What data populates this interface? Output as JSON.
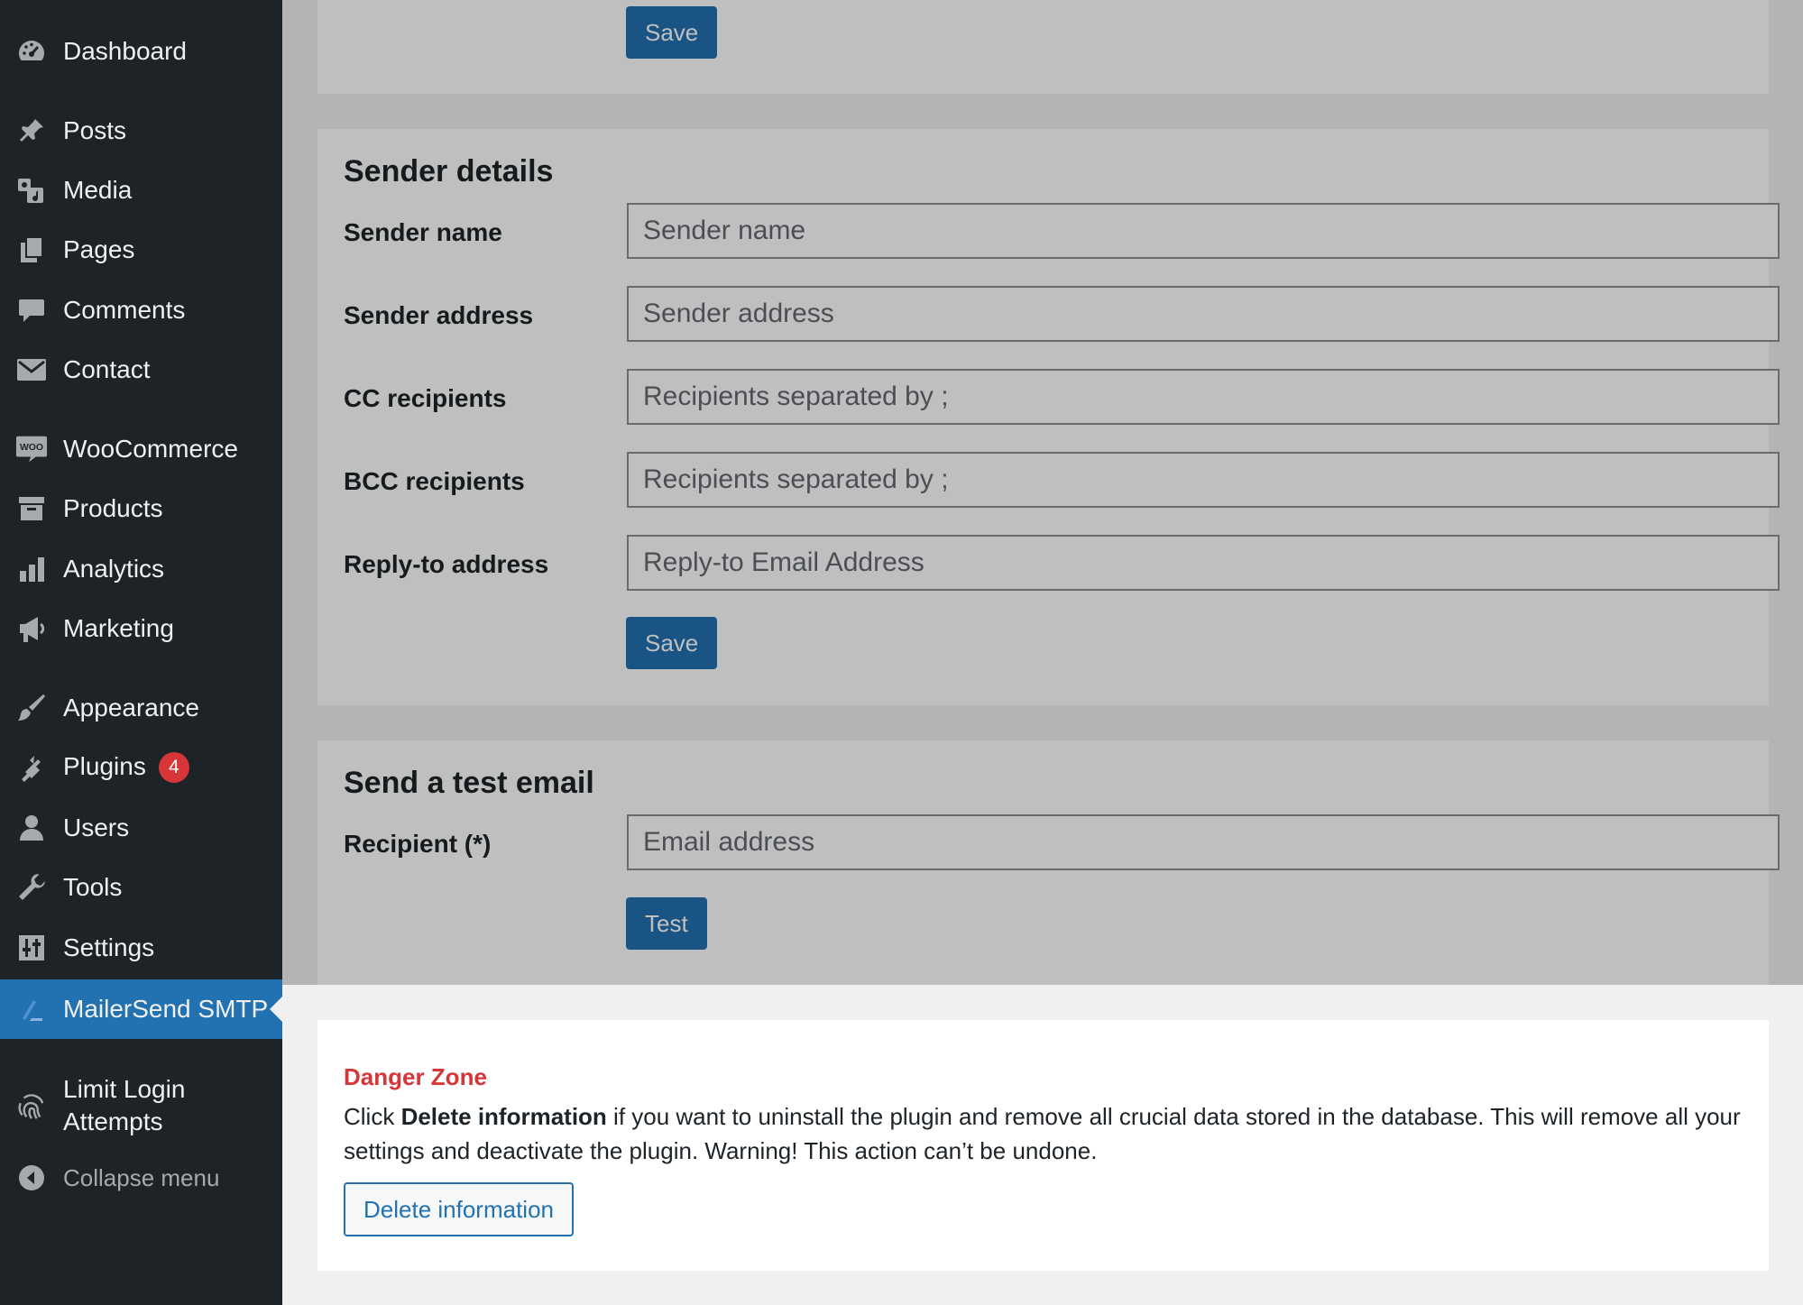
{
  "sidebar": {
    "items": [
      {
        "label": "Dashboard",
        "icon": "dashboard-icon"
      },
      {
        "label": "Posts",
        "icon": "pin-icon"
      },
      {
        "label": "Media",
        "icon": "media-icon"
      },
      {
        "label": "Pages",
        "icon": "pages-icon"
      },
      {
        "label": "Comments",
        "icon": "comment-icon"
      },
      {
        "label": "Contact",
        "icon": "envelope-icon"
      },
      {
        "label": "WooCommerce",
        "icon": "woo-icon"
      },
      {
        "label": "Products",
        "icon": "archive-icon"
      },
      {
        "label": "Analytics",
        "icon": "bar-chart-icon"
      },
      {
        "label": "Marketing",
        "icon": "megaphone-icon"
      },
      {
        "label": "Appearance",
        "icon": "brush-icon"
      },
      {
        "label": "Plugins",
        "icon": "plug-icon",
        "badge": "4"
      },
      {
        "label": "Users",
        "icon": "user-icon"
      },
      {
        "label": "Tools",
        "icon": "wrench-icon"
      },
      {
        "label": "Settings",
        "icon": "sliders-icon"
      },
      {
        "label": "MailerSend SMTP",
        "icon": "mailersend-icon"
      },
      {
        "label_line1": "Limit Login",
        "label_line2": "Attempts",
        "icon": "fingerprint-icon"
      },
      {
        "label": "Collapse menu",
        "icon": "collapse-arrow-icon"
      }
    ]
  },
  "top_section": {
    "save_label": "Save"
  },
  "sender_details": {
    "title": "Sender details",
    "fields": [
      {
        "label": "Sender name",
        "placeholder": "Sender name"
      },
      {
        "label": "Sender address",
        "placeholder": "Sender address"
      },
      {
        "label": "CC recipients",
        "placeholder": "Recipients separated by ;"
      },
      {
        "label": "BCC recipients",
        "placeholder": "Recipients separated by ;"
      },
      {
        "label": "Reply-to address",
        "placeholder": "Reply-to Email Address"
      }
    ],
    "save_label": "Save"
  },
  "test_email": {
    "title": "Send a test email",
    "recipient_label": "Recipient (*)",
    "recipient_placeholder": "Email address",
    "test_label": "Test"
  },
  "danger_zone": {
    "title": "Danger Zone",
    "text_before": "Click ",
    "text_bold": "Delete information",
    "text_after": " if you want to uninstall the plugin and remove all crucial data stored in the database. This will remove all your settings and deactivate the plugin. Warning! This action can’t be undone.",
    "button_label": "Delete information"
  },
  "colors": {
    "sidebar_bg": "#1d2327",
    "accent": "#2271b1",
    "danger": "#d63638"
  }
}
